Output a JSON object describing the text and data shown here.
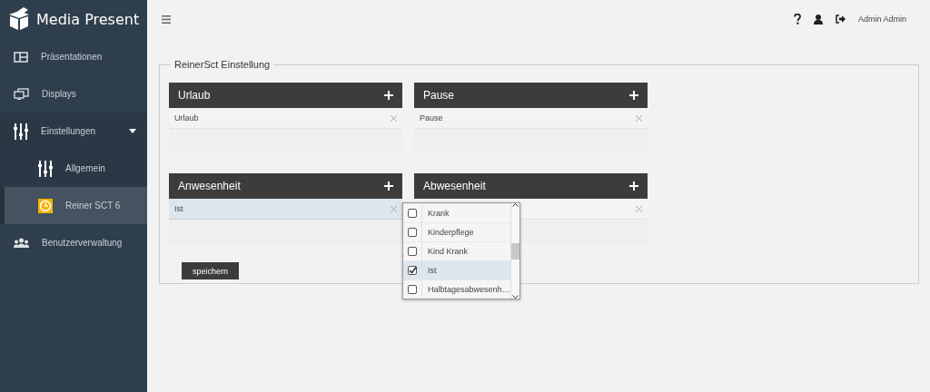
{
  "brand": {
    "title": "Media Present"
  },
  "sidebar": {
    "items": [
      {
        "label": "Präsentationen",
        "kind": "layout",
        "selected": false
      },
      {
        "label": "Displays",
        "kind": "displays",
        "selected": false
      },
      {
        "label": "Einstellungen",
        "kind": "sliders",
        "selected": false,
        "expanded": true,
        "children": [
          {
            "label": "Allgemein",
            "kind": "sliders",
            "selected": false
          },
          {
            "label": "Reiner SCT 6",
            "kind": "clock",
            "selected": true
          }
        ]
      },
      {
        "label": "Benutzerverwaltung",
        "kind": "users",
        "selected": false
      }
    ]
  },
  "topbar": {
    "user": "Admin Admin"
  },
  "fieldset": {
    "legend": "ReinerSct Einstellung"
  },
  "panels": [
    {
      "title": "Urlaub",
      "items": [
        {
          "label": "Urlaub",
          "selected": false
        }
      ]
    },
    {
      "title": "Pause",
      "items": [
        {
          "label": "Pause",
          "selected": false
        }
      ]
    },
    {
      "title": "Anwesenheit",
      "items": [
        {
          "label": "Ist",
          "selected": true
        }
      ]
    },
    {
      "title": "Abwesenheit",
      "items": [
        {
          "selected": false
        }
      ]
    }
  ],
  "dropdown": {
    "options": [
      {
        "label": "Krank",
        "checked": false
      },
      {
        "label": "Kinderpflege",
        "checked": false
      },
      {
        "label": "Kind Krank",
        "checked": false
      },
      {
        "label": "Ist",
        "checked": true
      },
      {
        "label": "Halbtagesabwesenh…",
        "checked": false
      }
    ]
  },
  "save_button": "speichern"
}
